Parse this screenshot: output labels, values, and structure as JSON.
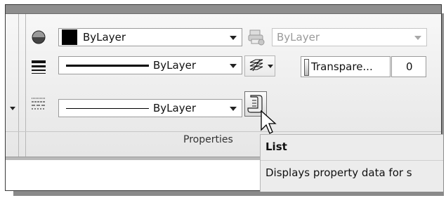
{
  "properties_panel": {
    "title": "Properties",
    "color_dropdown": {
      "value": "ByLayer"
    },
    "lineweight_dropdown": {
      "value": "ByLayer"
    },
    "linetype_dropdown": {
      "value": "ByLayer"
    },
    "plotstyle_dropdown": {
      "value": "ByLayer",
      "disabled": true
    },
    "transparency": {
      "label": "Transpare...",
      "value": "0"
    }
  },
  "tooltip": {
    "title": "List",
    "description": "Displays property data for s"
  },
  "icons": {
    "color_wheel": "color-wheel-icon",
    "lineweight": "lineweight-icon",
    "linetype": "linetype-icon",
    "plotstyle": "plot-style-icon",
    "layers": "layer-stack-icon",
    "list": "list-icon",
    "cursor": "mouse-cursor-icon"
  }
}
